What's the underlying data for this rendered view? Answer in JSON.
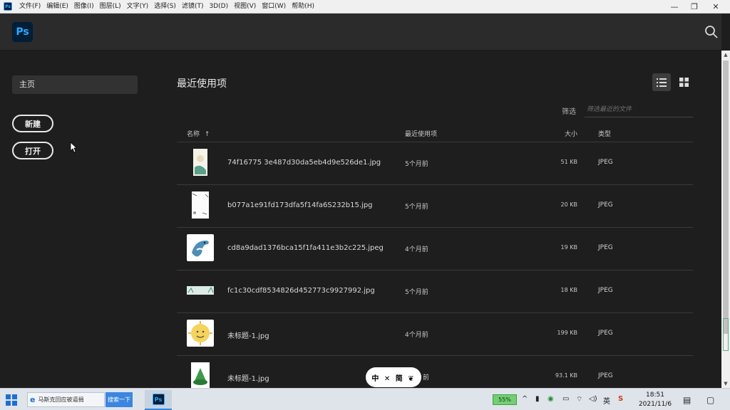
{
  "menubar": {
    "app_icon": "Ps",
    "items": [
      "文件(F)",
      "编辑(E)",
      "图像(I)",
      "图层(L)",
      "文字(Y)",
      "选择(S)",
      "滤镜(T)",
      "3D(D)",
      "视图(V)",
      "窗口(W)",
      "帮助(H)"
    ],
    "minimize": "—",
    "restore": "❐",
    "close": "✕"
  },
  "header": {
    "logo_text": "Ps",
    "search_icon": "search-icon"
  },
  "sidebar": {
    "home_label": "主页",
    "new_label": "新建",
    "open_label": "打开"
  },
  "main": {
    "title": "最近使用项",
    "view_list_icon": "list-view-icon",
    "view_grid_icon": "grid-view-icon",
    "filter_label": "筛选",
    "filter_placeholder": "筛选最近的文件",
    "columns": {
      "name": "名称",
      "sort_icon": "↑",
      "recent": "最近使用项",
      "size": "大小",
      "type": "类型"
    },
    "files": [
      {
        "name": "74f16775 3e487d30da5eb4d9e526de1.jpg",
        "recent": "5个月前",
        "size": "51 KB",
        "type": "JPEG"
      },
      {
        "name": "b077a1e91fd173dfa5f14fa6S232b15.jpg",
        "recent": "5个月前",
        "size": "20 KB",
        "type": "JPEG"
      },
      {
        "name": "cd8a9dad1376bca15f1fa411e3b2c225.jpeg",
        "recent": "4个月前",
        "size": "19 KB",
        "type": "JPEG"
      },
      {
        "name": "fc1c30cdf8534826d452773c9927992.jpg",
        "recent": "5个月前",
        "size": "18 KB",
        "type": "JPEG"
      },
      {
        "name": "未标题-1.jpg",
        "recent": "4个月前",
        "size": "199 KB",
        "type": "JPEG"
      },
      {
        "name": "未标题-1.jpg",
        "recent": "前",
        "size": "93.1 KB",
        "type": "JPEG"
      }
    ],
    "overlay_badge": "中 ✕ 简 ❦"
  },
  "taskbar": {
    "ie_text": "马斯克回应被逼捐",
    "search_button": "搜索一下",
    "ps_label": "Ps",
    "battery": "55%",
    "ime": "英",
    "ime2": "S",
    "time": "18:51",
    "date": "2021/11/6"
  }
}
